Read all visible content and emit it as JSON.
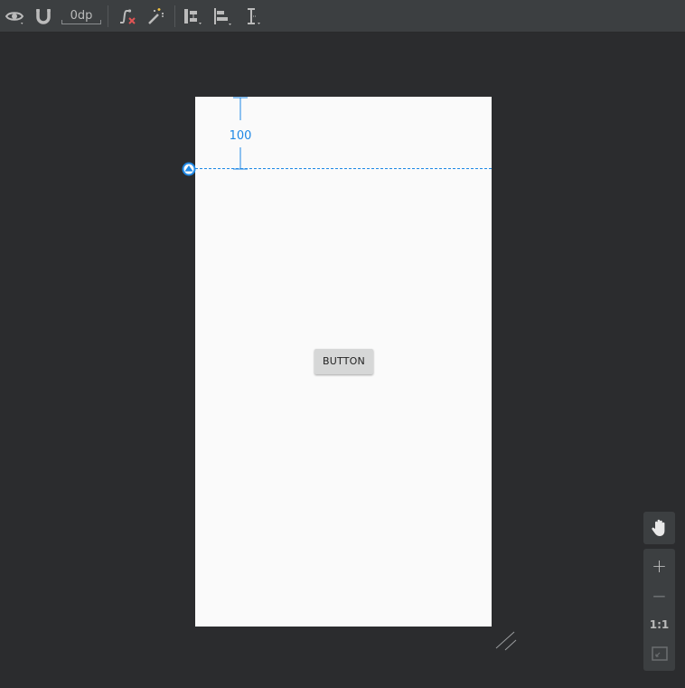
{
  "toolbar": {
    "default_margin": "0dp",
    "icons": {
      "view_options": "eye-icon",
      "autoconnect": "magnet-icon",
      "clear_constraints": "clear-constraints-icon",
      "infer_constraints": "magic-wand-icon",
      "pack": "pack-icon",
      "align": "align-icon",
      "guidelines": "guidelines-icon"
    }
  },
  "canvas": {
    "guideline_offset_label": "100",
    "button_label": "BUTTON"
  },
  "zoom_controls": {
    "pan": "hand-icon",
    "zoom_in": "+",
    "zoom_out": "−",
    "actual_size": "1:1",
    "fit": "zoom-to-fit-icon"
  },
  "colors": {
    "accent": "#1e88e5",
    "toolbar_bg": "#3c3f41",
    "canvas_bg": "#2b2c2e",
    "device_bg": "#fafafa",
    "button_bg": "#d6d7d7"
  }
}
